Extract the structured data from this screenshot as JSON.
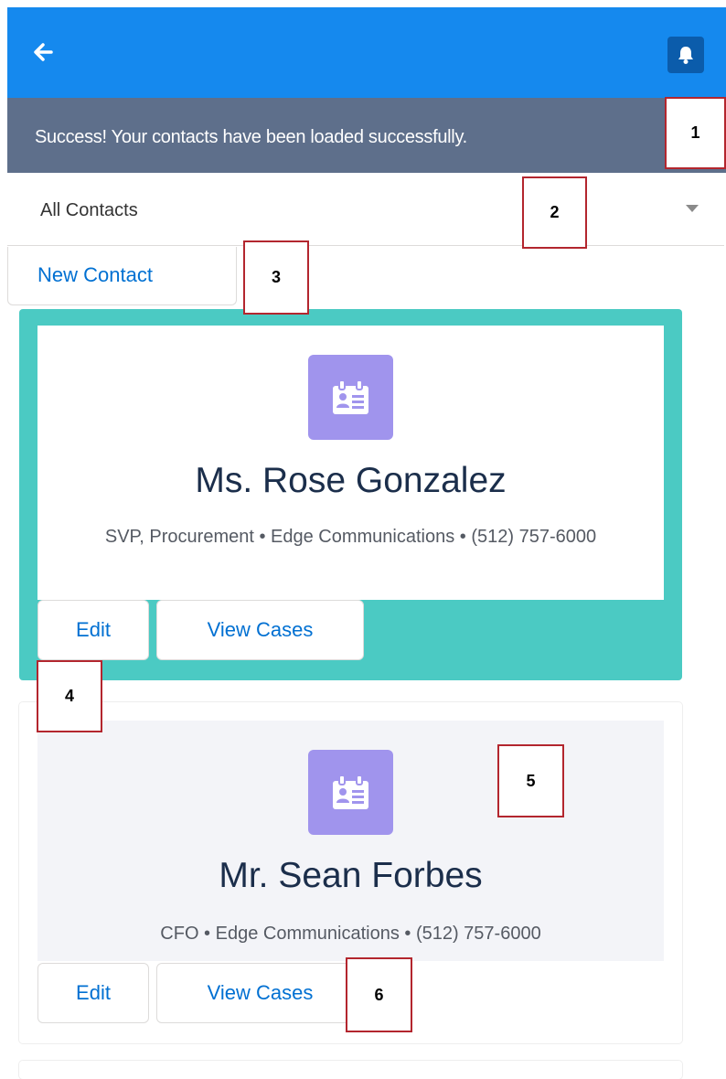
{
  "header": {
    "back_icon": "arrow-left-icon",
    "notification_icon": "bell-icon",
    "accent_color": "#1589ee"
  },
  "toast": {
    "message": "Success! Your contacts have been loaded successfully.",
    "color": "#5e6f8b"
  },
  "filter": {
    "selected": "All Contacts",
    "caret_icon": "caret-down-icon"
  },
  "actions": {
    "new_contact_label": "New Contact"
  },
  "callouts": [
    "1",
    "2",
    "3",
    "4",
    "5",
    "6"
  ],
  "contacts": [
    {
      "name": "Ms. Rose Gonzalez",
      "detail": "SVP, Procurement • Edge Communications • (512) 757-6000",
      "avatar_icon": "contact-card-icon",
      "selected": true,
      "edit_label": "Edit",
      "view_cases_label": "View Cases"
    },
    {
      "name": "Mr. Sean Forbes",
      "detail": "CFO • Edge Communications • (512) 757-6000",
      "avatar_icon": "contact-card-icon",
      "selected": false,
      "edit_label": "Edit",
      "view_cases_label": "View Cases"
    }
  ],
  "colors": {
    "selected_card": "#4bcac3",
    "avatar": "#a094ed",
    "link": "#0070d2"
  }
}
